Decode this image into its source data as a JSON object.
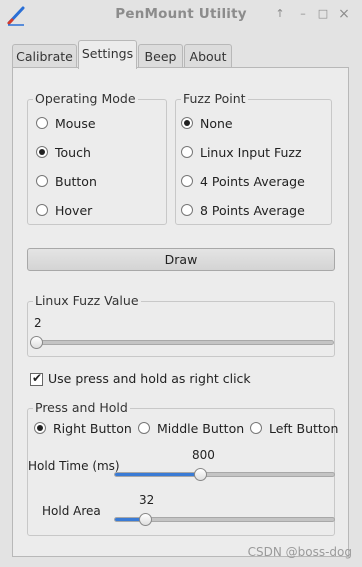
{
  "window": {
    "title": "PenMount Utility",
    "buttons": {
      "pin": "↑",
      "minimize": "–",
      "maximize": "□",
      "close": "×"
    }
  },
  "tabs": [
    {
      "label": "Calibrate",
      "active": false
    },
    {
      "label": "Settings",
      "active": true
    },
    {
      "label": "Beep",
      "active": false
    },
    {
      "label": "About",
      "active": false
    }
  ],
  "operating_mode": {
    "title": "Operating Mode",
    "options": [
      "Mouse",
      "Touch",
      "Button",
      "Hover"
    ],
    "selected": "Touch"
  },
  "fuzz_point": {
    "title": "Fuzz Point",
    "options": [
      "None",
      "Linux Input Fuzz",
      "4 Points Average",
      "8 Points Average"
    ],
    "selected": "None"
  },
  "draw_button": {
    "label": "Draw"
  },
  "linux_fuzz": {
    "title": "Linux Fuzz Value",
    "value": "2",
    "fraction": 0.02
  },
  "right_click_checkbox": {
    "label": "Use press and hold as right click",
    "checked": true
  },
  "press_and_hold": {
    "title": "Press and Hold",
    "buttons": [
      "Right Button",
      "Middle Button",
      "Left Button"
    ],
    "selected": "Right Button",
    "hold_time": {
      "label": "Hold Time (ms)",
      "value": "800",
      "fraction": 0.39
    },
    "hold_area": {
      "label": "Hold Area",
      "value": "32",
      "fraction": 0.14
    }
  },
  "watermark": "CSDN @boss-dog",
  "colors": {
    "accent": "#3a7bd5",
    "background": "#ececec"
  }
}
